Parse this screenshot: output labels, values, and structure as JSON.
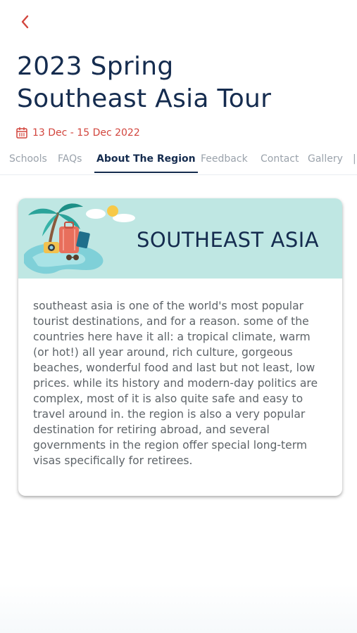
{
  "header": {
    "back_icon": "chevron-left-icon",
    "title_line1": "2023 Spring",
    "title_line2": "Southeast Asia Tour",
    "date_icon": "calendar-icon",
    "date_range": "13 Dec - 15 Dec 2022"
  },
  "tabs": [
    {
      "label": "Schools",
      "active": false
    },
    {
      "label": "FAQs",
      "active": false
    },
    {
      "label": "About The Region",
      "active": true
    },
    {
      "label": "Feedback",
      "active": false
    },
    {
      "label": "Contact",
      "active": false
    },
    {
      "label": "Gallery",
      "active": false
    }
  ],
  "card": {
    "banner_title": "SOUTHEAST ASIA",
    "banner_image": "travel-island-illustration",
    "body": "southeast asia is one of the world's most popular tourist destinations, and for a reason. some of the countries here have it all: a tropical climate, warm (or hot!) all year around, rich culture, gorgeous beaches, wonderful food and last but not least, low prices. while its history and modern-day politics are complex, most of it is also quite safe and easy to travel around in. the region is also a very popular destination for retiring abroad, and several governments in the region offer special long-term visas specifically for retirees."
  },
  "colors": {
    "primary": "#152c4f",
    "accent": "#d2453d",
    "banner_bg": "#bfe7e3",
    "muted_text": "#9aa2ab"
  }
}
